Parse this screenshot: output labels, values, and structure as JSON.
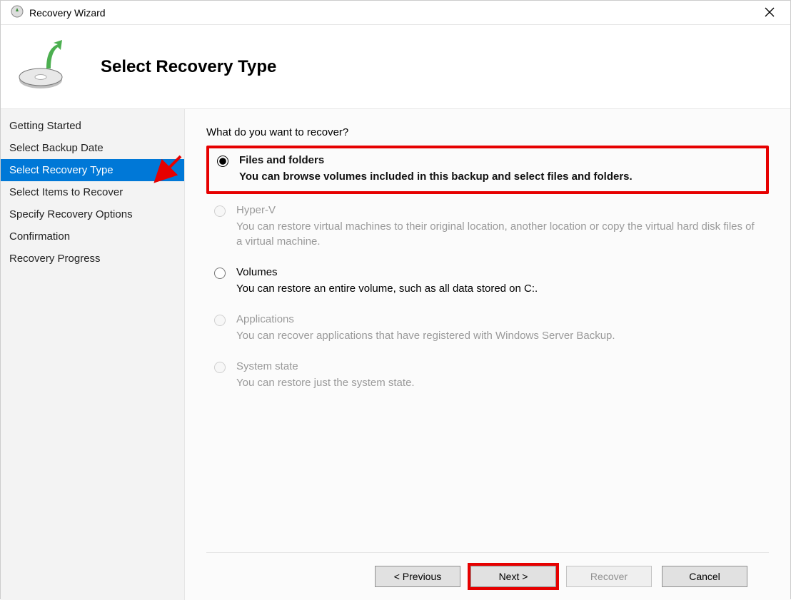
{
  "window": {
    "title": "Recovery Wizard"
  },
  "header": {
    "heading": "Select Recovery Type"
  },
  "sidebar": {
    "items": [
      {
        "label": "Getting Started",
        "active": false
      },
      {
        "label": "Select Backup Date",
        "active": false
      },
      {
        "label": "Select Recovery Type",
        "active": true
      },
      {
        "label": "Select Items to Recover",
        "active": false
      },
      {
        "label": "Specify Recovery Options",
        "active": false
      },
      {
        "label": "Confirmation",
        "active": false
      },
      {
        "label": "Recovery Progress",
        "active": false
      }
    ]
  },
  "content": {
    "prompt": "What do you want to recover?",
    "options": [
      {
        "id": "files",
        "label": "Files and folders",
        "desc": "You can browse volumes included in this backup and select files and folders.",
        "selected": true,
        "disabled": false,
        "highlighted": true
      },
      {
        "id": "hyperv",
        "label": "Hyper-V",
        "desc": "You can restore virtual machines to their original location, another location or copy the virtual hard disk files of a virtual machine.",
        "selected": false,
        "disabled": true,
        "highlighted": false
      },
      {
        "id": "volumes",
        "label": "Volumes",
        "desc": "You can restore an entire volume, such as all data stored on C:.",
        "selected": false,
        "disabled": false,
        "highlighted": false
      },
      {
        "id": "applications",
        "label": "Applications",
        "desc": "You can recover applications that have registered with Windows Server Backup.",
        "selected": false,
        "disabled": true,
        "highlighted": false
      },
      {
        "id": "systemstate",
        "label": "System state",
        "desc": "You can restore just the system state.",
        "selected": false,
        "disabled": true,
        "highlighted": false
      }
    ]
  },
  "footer": {
    "previous": "< Previous",
    "next": "Next >",
    "recover": "Recover",
    "cancel": "Cancel",
    "next_highlighted": true,
    "recover_disabled": true
  }
}
